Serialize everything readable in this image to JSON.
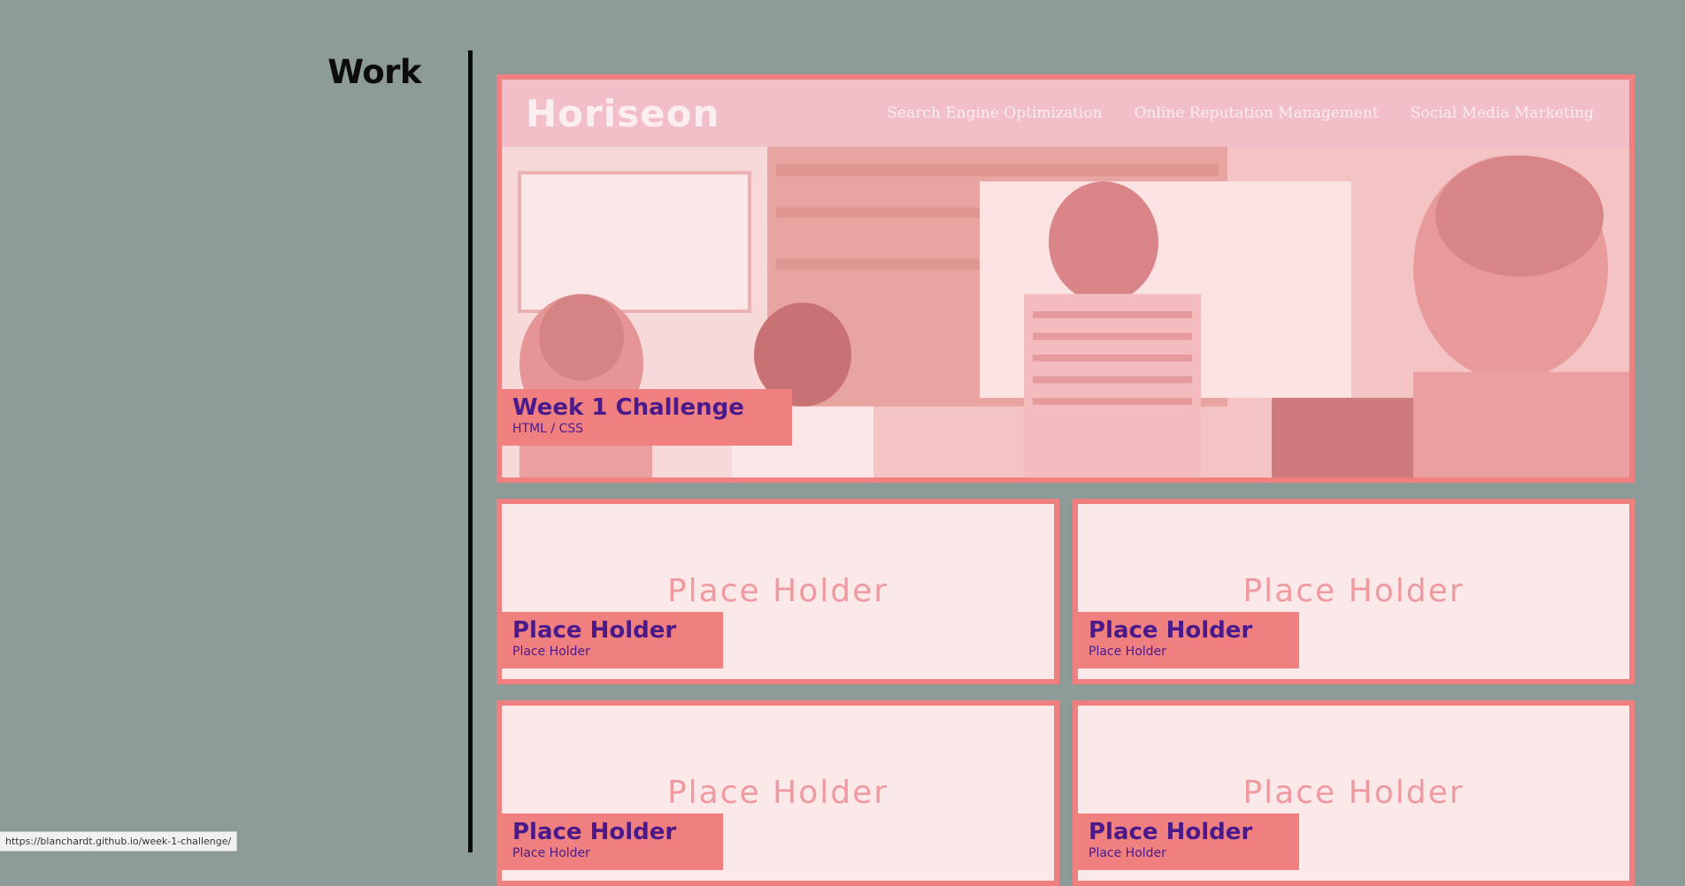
{
  "section": {
    "heading": "Work"
  },
  "featured": {
    "logo": "Horiseon",
    "nav": [
      "Search Engine Optimization",
      "Online Reputation Management",
      "Social Media Marketing"
    ],
    "title": "Week 1 Challenge",
    "subtitle": "HTML / CSS"
  },
  "cards": [
    {
      "placeholder": "Place Holder",
      "title": "Place Holder",
      "subtitle": "Place Holder"
    },
    {
      "placeholder": "Place Holder",
      "title": "Place Holder",
      "subtitle": "Place Holder"
    },
    {
      "placeholder": "Place Holder",
      "title": "Place Holder",
      "subtitle": "Place Holder"
    },
    {
      "placeholder": "Place Holder",
      "title": "Place Holder",
      "subtitle": "Place Holder"
    }
  ],
  "status_bar": {
    "url": "https://blanchardt.github.io/week-1-challenge/"
  },
  "colors": {
    "page_background": "#8c9b98",
    "card_border": "#f08080",
    "caption_text": "#4a1a8a",
    "placeholder_background": "#fbe9ea"
  }
}
